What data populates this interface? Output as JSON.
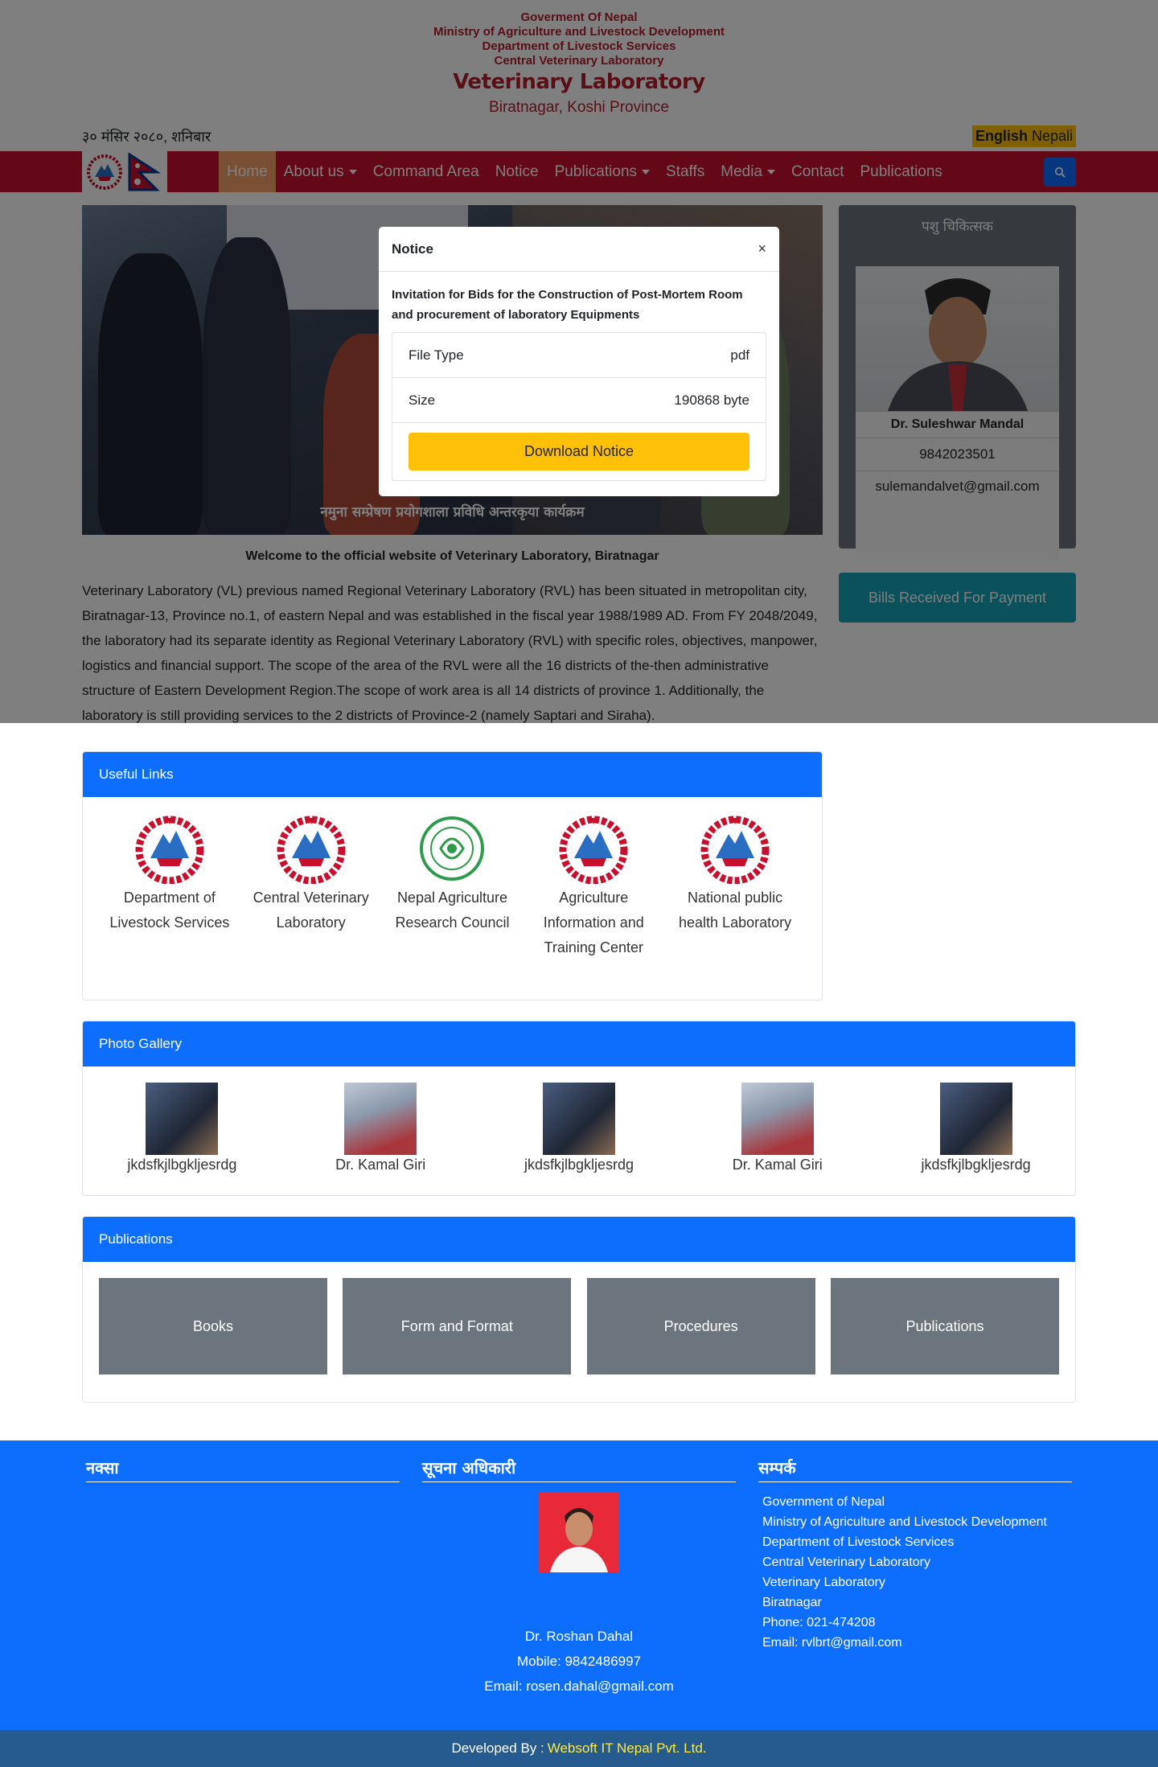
{
  "header": {
    "gov_line1": "Goverment Of Nepal",
    "gov_line2": "Ministry of Agriculture and Livestock Development",
    "gov_line3": "Department of Livestock Services",
    "gov_line4": "Central Veterinary Laboratory",
    "title": "Veterinary Laboratory",
    "subtitle": "Biratnagar, Koshi Province",
    "date": "३० मंसिर २०८०, शनिबार",
    "lang_en": "English",
    "lang_np": "Nepali"
  },
  "nav": {
    "items": [
      {
        "label": "Home",
        "active": true,
        "dropdown": false
      },
      {
        "label": "About us",
        "dropdown": true
      },
      {
        "label": "Command Area",
        "dropdown": false
      },
      {
        "label": "Notice",
        "dropdown": false
      },
      {
        "label": "Publications",
        "dropdown": true
      },
      {
        "label": "Staffs",
        "dropdown": false
      },
      {
        "label": "Media",
        "dropdown": true
      },
      {
        "label": "Contact",
        "dropdown": false
      },
      {
        "label": "Publications",
        "dropdown": false
      }
    ],
    "search_icon": "search-icon"
  },
  "slider": {
    "caption": "नमुना सम्प्रेषण प्रयोगशाला प्रविधि अन्तरकृया कार्यक्रम"
  },
  "main": {
    "welcome": "Welcome to the official website of Veterinary Laboratory, Biratnagar",
    "intro": "Veterinary Laboratory (VL) previous named Regional Veterinary Laboratory (RVL) has been situated in metropolitan city, Biratnagar-13, Province no.1, of eastern Nepal and was established in the fiscal year 1988/1989 AD. From FY 2048/2049, the laboratory had its separate identity as Regional Veterinary Laboratory (RVL) with specific roles, objectives, manpower, logistics and financial support. The scope of the area of the RVL were all the 16 districts of the-then administrative structure of Eastern Development Region.The scope of work area is all 14 districts of province 1. Additionally, the laboratory is still providing services to the 2 districts of Province-2 (namely Saptari and Siraha)."
  },
  "useful_links": {
    "title": "Useful Links",
    "items": [
      {
        "label": "Department of Livestock Services",
        "icon": "nepal-emblem-icon"
      },
      {
        "label": "Central Veterinary Laboratory",
        "icon": "nepal-emblem-icon"
      },
      {
        "label": "Nepal Agriculture Research Council",
        "icon": "narc-logo-icon"
      },
      {
        "label": "Agriculture Information and Training Center",
        "icon": "nepal-emblem-icon"
      },
      {
        "label": "National public health Laboratory",
        "icon": "nepal-emblem-icon"
      }
    ]
  },
  "profile": {
    "title": "पशु चिकित्सक",
    "name": "Dr. Suleshwar Mandal",
    "phone": "9842023501",
    "email": "sulemandalvet@gmail.com"
  },
  "bills": {
    "label": "Bills Received For Payment"
  },
  "gallery": {
    "title": "Photo Gallery",
    "items": [
      {
        "caption": "jkdsfkjlbgkljesrdg"
      },
      {
        "caption": "Dr. Kamal Giri"
      },
      {
        "caption": "jkdsfkjlbgkljesrdg"
      },
      {
        "caption": "Dr. Kamal Giri"
      },
      {
        "caption": "jkdsfkjlbgkljesrdg"
      }
    ]
  },
  "publications": {
    "title": "Publications",
    "items": [
      "Books",
      "Form and Format",
      "Procedures",
      "Publications"
    ]
  },
  "modal": {
    "title": "Notice",
    "close": "×",
    "description": "Invitation for Bids for the Construction of Post-Mortem Room and procurement of laboratory Equipments",
    "file_type_label": "File Type",
    "file_type_value": "pdf",
    "size_label": "Size",
    "size_value": "190868 byte",
    "download_label": "Download Notice"
  },
  "footer": {
    "map_title": "नक्सा",
    "officer_title": "सूचना अधिकारी",
    "officer_name": "Dr. Roshan Dahal",
    "officer_mobile": "Mobile: 9842486997",
    "officer_email": "Email: rosen.dahal@gmail.com",
    "contact_title": "सम्पर्क",
    "contact_lines": [
      "Government of Nepal",
      "Ministry of Agriculture and Livestock Development",
      "Department of Livestock Services",
      "Central Veterinary Laboratory",
      "Veterinary Laboratory",
      "Biratnagar",
      "Phone: 021-474208",
      "Email: rvlbrt@gmail.com"
    ],
    "developed_by": "Developed By :",
    "developer": "Websoft IT Nepal Pvt. Ltd."
  },
  "colors": {
    "primary_red": "#c8102e",
    "title_red": "#b21f2d",
    "primary_blue": "#0d6efd",
    "teal": "#17a2b8",
    "gray": "#6c757d",
    "yellow": "#ffc107"
  }
}
